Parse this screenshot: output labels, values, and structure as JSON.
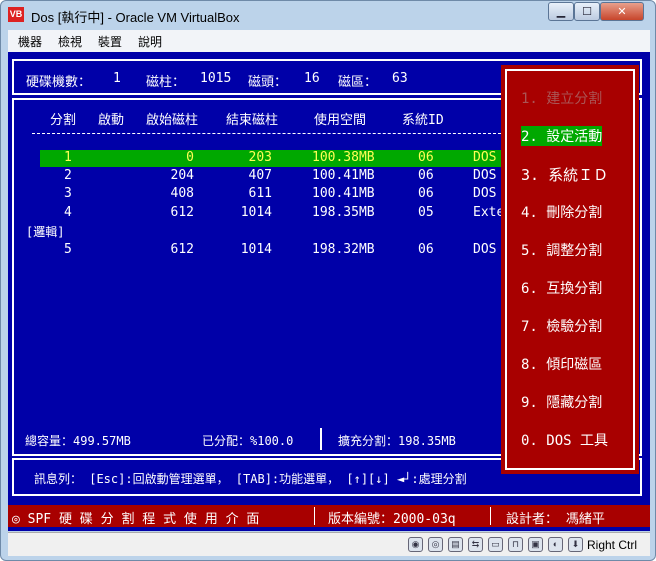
{
  "window": {
    "title": "Dos [執行中] - Oracle VM VirtualBox",
    "icon_text": "VB"
  },
  "menubar": [
    "機器",
    "檢視",
    "裝置",
    "說明"
  ],
  "header": {
    "disk_count_label": "硬碟機數：",
    "disk_count": "1",
    "cyl_label": "磁柱：",
    "cyl": "1015",
    "head_label": "磁頭：",
    "head": "16",
    "sector_label": "磁區：",
    "sector": "63"
  },
  "table": {
    "columns": [
      "分割",
      "啟動",
      "啟始磁柱",
      "結束磁柱",
      "使用空間",
      "系統ID"
    ],
    "rows": [
      {
        "part": "1",
        "start": "0",
        "end": "203",
        "size": "100.38MB",
        "sysid": "06",
        "type": "DOS",
        "selected": true
      },
      {
        "part": "2",
        "start": "204",
        "end": "407",
        "size": "100.41MB",
        "sysid": "06",
        "type": "DOS"
      },
      {
        "part": "3",
        "start": "408",
        "end": "611",
        "size": "100.41MB",
        "sysid": "06",
        "type": "DOS"
      },
      {
        "part": "4",
        "start": "612",
        "end": "1014",
        "size": "198.35MB",
        "sysid": "05",
        "type": "Exte"
      },
      {
        "part": "5",
        "start": "612",
        "end": "1014",
        "size": "198.32MB",
        "sysid": "06",
        "type": "DOS"
      }
    ],
    "logical_label": "[邏輯]"
  },
  "summary": {
    "total": "總容量：499.57MB",
    "allocated": "已分配：%100.0",
    "extended": "擴充分割：198.35MB"
  },
  "menu": [
    {
      "label": "1. 建立分割",
      "dim": true
    },
    {
      "label": "2. 設定活動",
      "active": true
    },
    {
      "label": "3. 系統ＩＤ"
    },
    {
      "label": "4. 刪除分割"
    },
    {
      "label": "5. 調整分割"
    },
    {
      "label": "6. 互換分割"
    },
    {
      "label": "7. 檢驗分割"
    },
    {
      "label": "8. 傾印磁區"
    },
    {
      "label": "9. 隱藏分割"
    },
    {
      "label": "0. DOS 工具"
    }
  ],
  "message": "訊息列： [Esc]:回啟動管理選單， [TAB]:功能選單， [↑][↓] ◄┘:處理分割",
  "statusbar": {
    "left": "◎ SPF 硬 碟 分 割 程 式 使 用 介 面",
    "version": "版本編號：2000-03q",
    "author": "設計者： 馮緒平"
  },
  "vbox_status": {
    "host_key": "Right Ctrl"
  },
  "colors": {
    "screen": "#0000a8",
    "menu": "#a80000",
    "highlight": "#00a800",
    "yellow": "#ffff55"
  }
}
